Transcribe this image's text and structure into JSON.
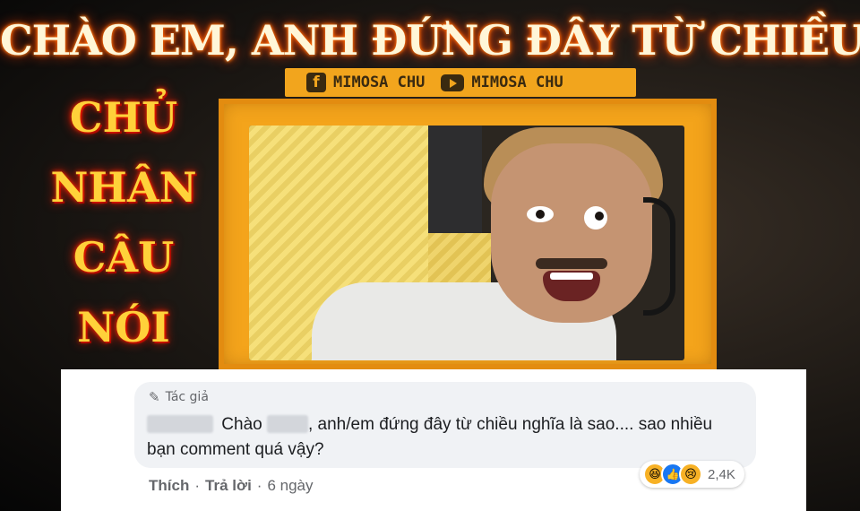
{
  "headline": "CHÀO EM, ANH ĐỨNG ĐÂY TỪ CHIỀU",
  "side_words": [
    "CHỦ",
    "NHÂN",
    "CÂU",
    "NÓI"
  ],
  "social": {
    "facebook": {
      "icon": "facebook-icon",
      "label": "MIMOSA CHU"
    },
    "youtube": {
      "icon": "youtube-icon",
      "label": "MIMOSA CHU"
    }
  },
  "comment": {
    "author_badge": "Tác giả",
    "text_start": "Chào",
    "text_rest": ", anh/em đứng đây từ chiều nghĩa là sao.... sao nhiều bạn comment quá vậy?",
    "reactions": {
      "icons": [
        "haha-icon",
        "like-icon",
        "sad-icon"
      ],
      "count": "2,4K"
    },
    "actions": {
      "like": "Thích",
      "reply": "Trả lời",
      "separator": "·",
      "time": "6 ngày"
    }
  },
  "colors": {
    "frame_orange": "#f4a41b",
    "headline_glow": "#ff6a00",
    "side_text": "#ffd13a",
    "fb_bubble": "#f0f2f5",
    "fb_blue": "#1877f2"
  }
}
